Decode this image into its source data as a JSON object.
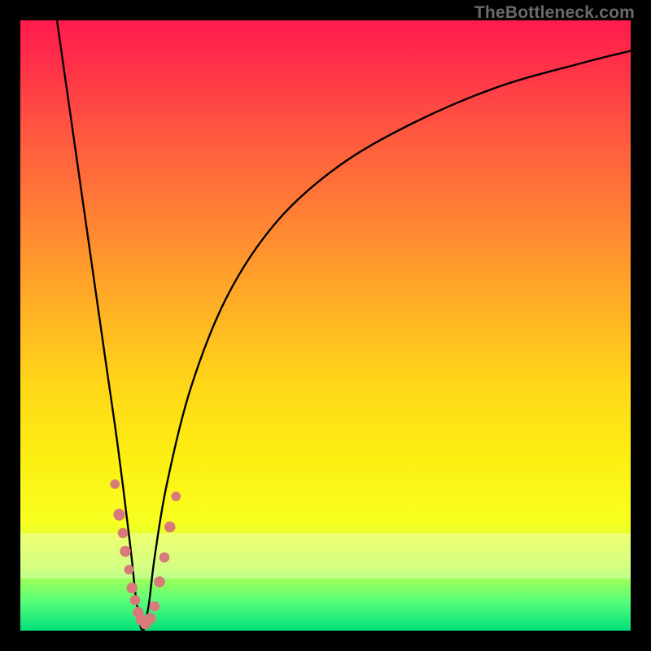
{
  "watermark": "TheBottleneck.com",
  "chart_data": {
    "type": "line",
    "title": "",
    "xlabel": "",
    "ylabel": "",
    "xlim": [
      0,
      100
    ],
    "ylim": [
      0,
      100
    ],
    "grid": false,
    "legend": false,
    "series": [
      {
        "name": "bottleneck-curve",
        "x": [
          6,
          8,
          10,
          12,
          14,
          16,
          18,
          19,
          20,
          21,
          22,
          24,
          28,
          34,
          42,
          52,
          64,
          78,
          92,
          100
        ],
        "y": [
          100,
          86,
          72,
          58,
          44,
          30,
          14,
          5,
          0,
          4,
          12,
          24,
          40,
          55,
          67,
          76,
          83,
          89,
          93,
          95
        ],
        "color": "#000000"
      }
    ],
    "markers": [
      {
        "x": 15.5,
        "y": 24,
        "r": 1.3
      },
      {
        "x": 16.2,
        "y": 19,
        "r": 1.6
      },
      {
        "x": 16.8,
        "y": 16,
        "r": 1.4
      },
      {
        "x": 17.2,
        "y": 13,
        "r": 1.5
      },
      {
        "x": 17.8,
        "y": 10,
        "r": 1.3
      },
      {
        "x": 18.3,
        "y": 7,
        "r": 1.5
      },
      {
        "x": 18.8,
        "y": 5,
        "r": 1.4
      },
      {
        "x": 19.3,
        "y": 3,
        "r": 1.5
      },
      {
        "x": 19.8,
        "y": 1.8,
        "r": 1.5
      },
      {
        "x": 20.5,
        "y": 1.2,
        "r": 1.6
      },
      {
        "x": 21.3,
        "y": 2,
        "r": 1.5
      },
      {
        "x": 22.0,
        "y": 4,
        "r": 1.4
      },
      {
        "x": 22.8,
        "y": 8,
        "r": 1.5
      },
      {
        "x": 23.6,
        "y": 12,
        "r": 1.4
      },
      {
        "x": 24.5,
        "y": 17,
        "r": 1.5
      },
      {
        "x": 25.5,
        "y": 22,
        "r": 1.3
      }
    ],
    "marker_color": "#d97a7a",
    "background_gradient": {
      "top": "#ff1a4d",
      "mid": "#ffd400",
      "bottom": "#00e07a"
    }
  }
}
